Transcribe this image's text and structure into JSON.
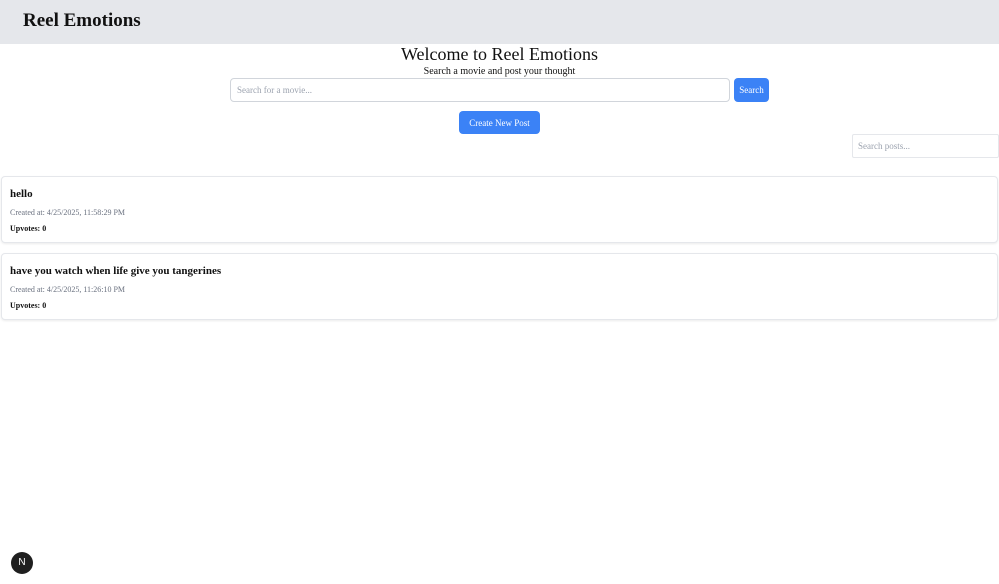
{
  "header": {
    "brand": "Reel Emotions"
  },
  "hero": {
    "title": "Welcome to Reel Emotions",
    "subtitle": "Search a movie and post your thought"
  },
  "movie_search": {
    "placeholder": "Search for a movie...",
    "button_label": "Search"
  },
  "create_post": {
    "label": "Create New Post"
  },
  "post_search": {
    "placeholder": "Search posts..."
  },
  "posts": [
    {
      "title": "hello",
      "created": "Created at: 4/25/2025, 11:58:29 PM",
      "upvotes": "Upvotes: 0"
    },
    {
      "title": "have you watch when life give you tangerines",
      "created": "Created at: 4/25/2025, 11:26:10 PM",
      "upvotes": "Upvotes: 0"
    }
  ],
  "dev_badge": {
    "label": "N"
  },
  "colors": {
    "topbar": "#e5e7eb",
    "accent": "#3b82f6",
    "badge": "#1f1f1f"
  }
}
